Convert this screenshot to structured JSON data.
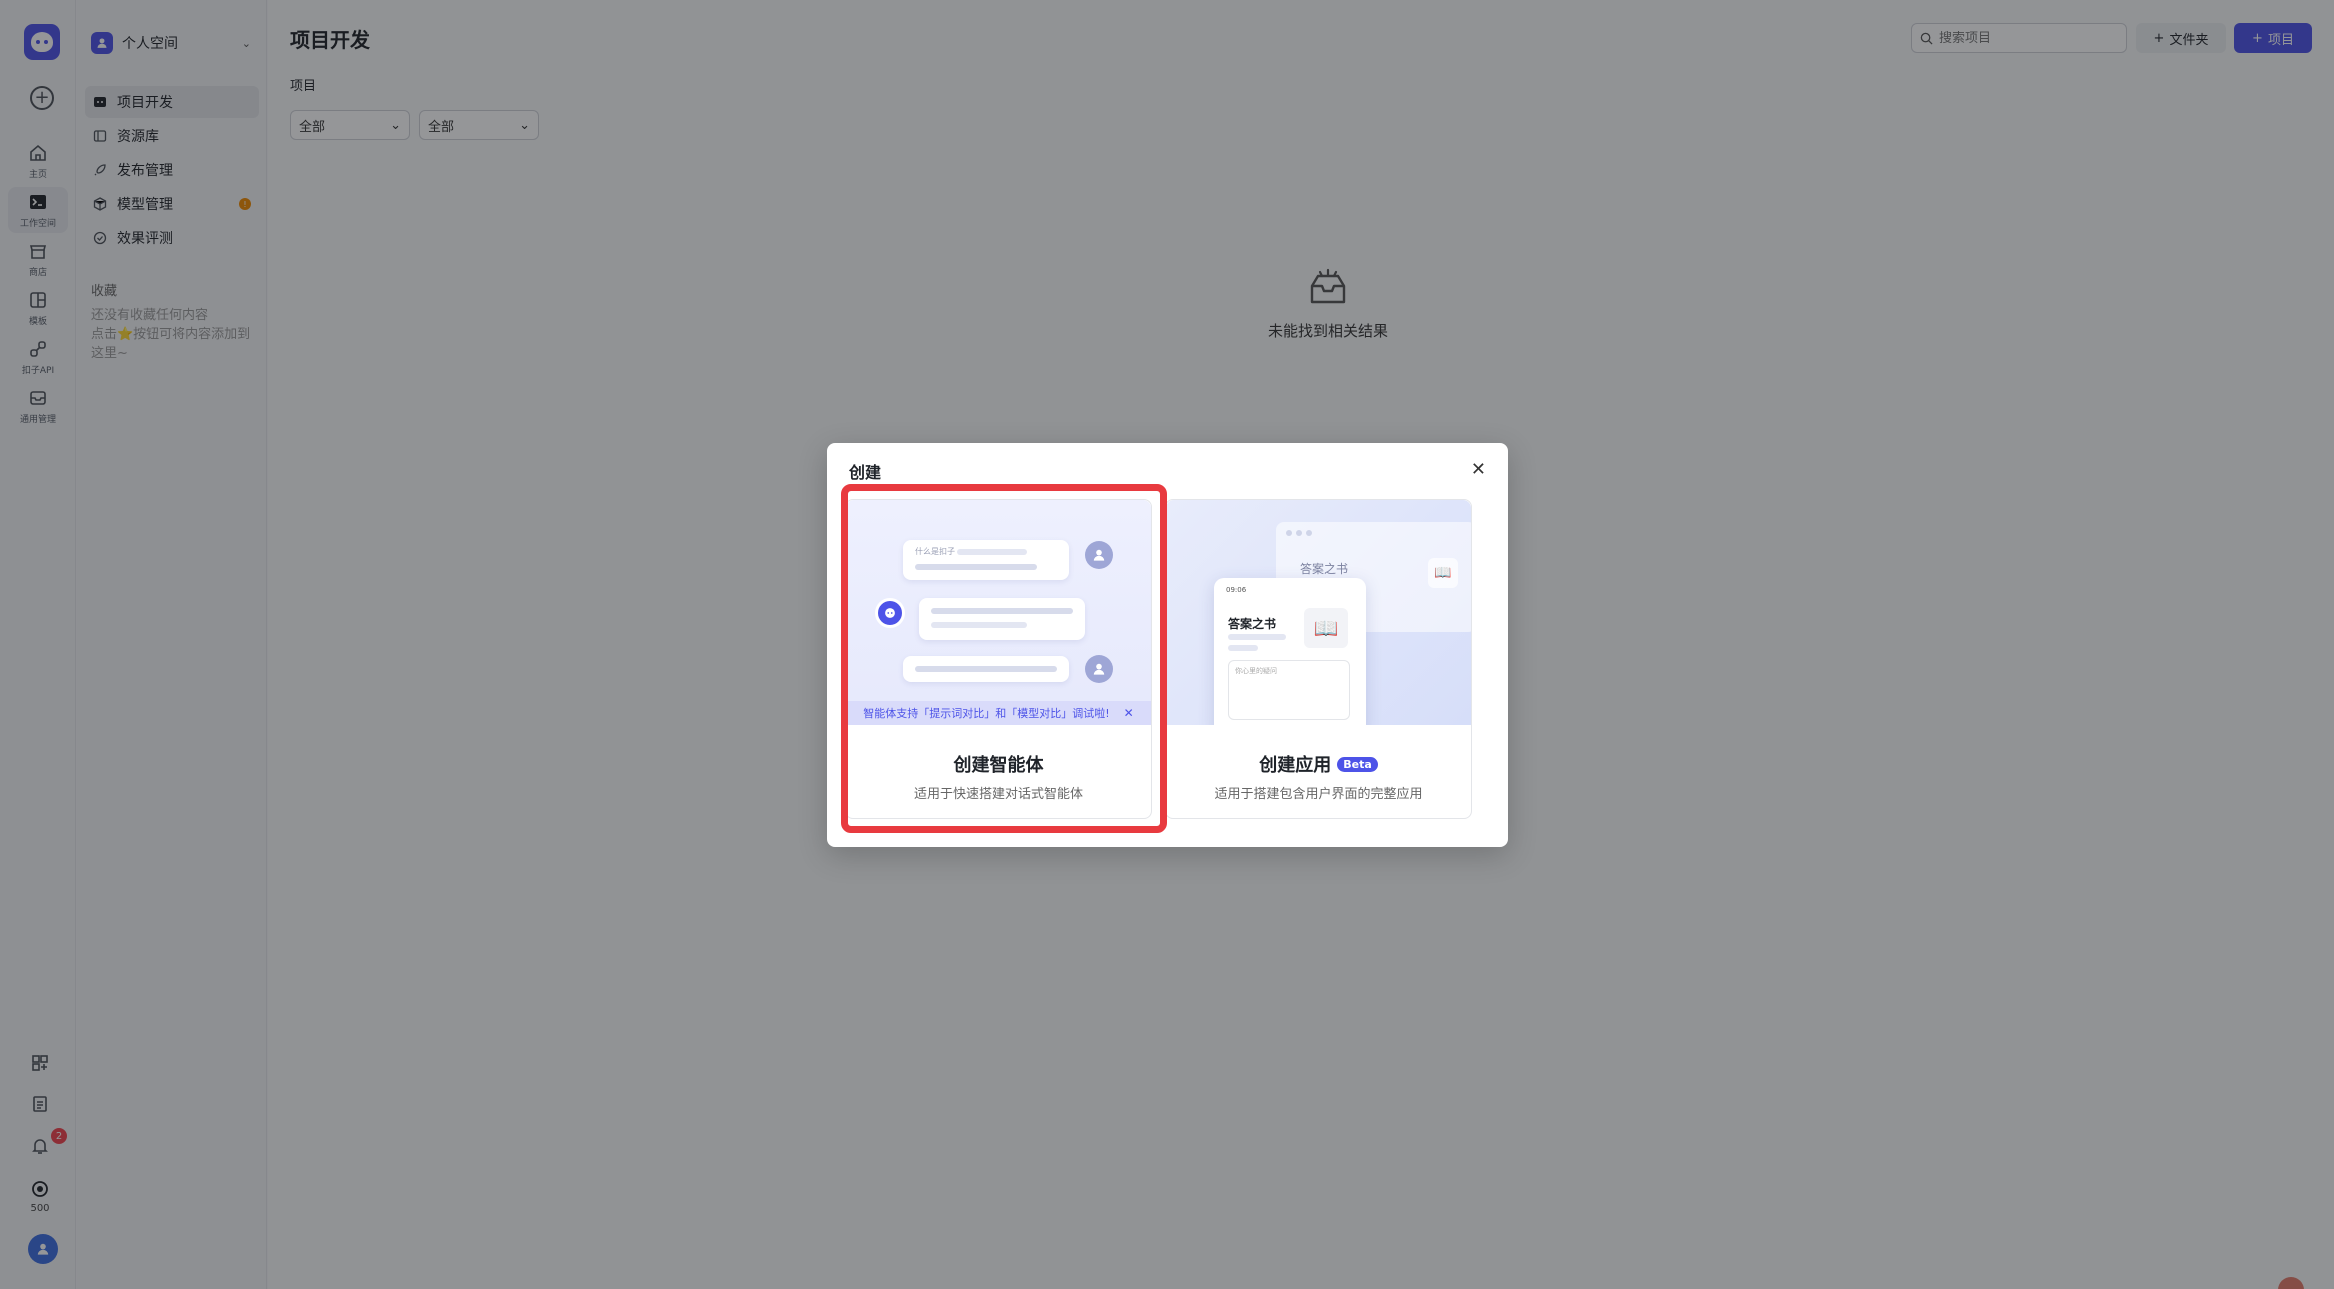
{
  "rail": {
    "items": [
      {
        "label": "主页",
        "icon": "home-icon"
      },
      {
        "label": "工作空间",
        "icon": "terminal-icon"
      },
      {
        "label": "商店",
        "icon": "store-icon"
      },
      {
        "label": "模板",
        "icon": "template-icon"
      },
      {
        "label": "扣子API",
        "icon": "api-icon"
      },
      {
        "label": "通用管理",
        "icon": "inbox-icon"
      }
    ],
    "notification_count": "2",
    "credits": "500"
  },
  "sidebar": {
    "space_label": "个人空间",
    "nav": [
      {
        "label": "项目开发",
        "icon": "project-icon"
      },
      {
        "label": "资源库",
        "icon": "library-icon"
      },
      {
        "label": "发布管理",
        "icon": "rocket-icon"
      },
      {
        "label": "模型管理",
        "icon": "model-icon",
        "badge": "!"
      },
      {
        "label": "效果评测",
        "icon": "evaluate-icon"
      }
    ],
    "favorites_title": "收藏",
    "favorites_empty_line1": "还没有收藏任何内容",
    "favorites_empty_line2": "点击⭐按钮可将内容添加到这里~"
  },
  "header": {
    "title": "项目开发",
    "search_placeholder": "搜索项目",
    "folder_button": "文件夹",
    "project_button": "项目"
  },
  "filters": {
    "section_label": "项目",
    "filter1": "全部",
    "filter2": "全部"
  },
  "empty_state": {
    "text": "未能找到相关结果"
  },
  "modal": {
    "title": "创建",
    "cards": {
      "agent": {
        "name": "创建智能体",
        "desc": "适用于快速搭建对话式智能体",
        "bubble_caption": "什么是扣子",
        "notice": "智能体支持「提示词对比」和「模型对比」调试啦!"
      },
      "app": {
        "name": "创建应用",
        "badge": "Beta",
        "desc": "适用于搭建包含用户界面的完整应用",
        "window_title": "答案之书",
        "phone_title": "答案之书",
        "phone_status": "09:06",
        "phone_input_hint": "你心里的疑问"
      }
    }
  },
  "colors": {
    "accent": "#4d53e8",
    "highlight": "#e83a3f"
  }
}
